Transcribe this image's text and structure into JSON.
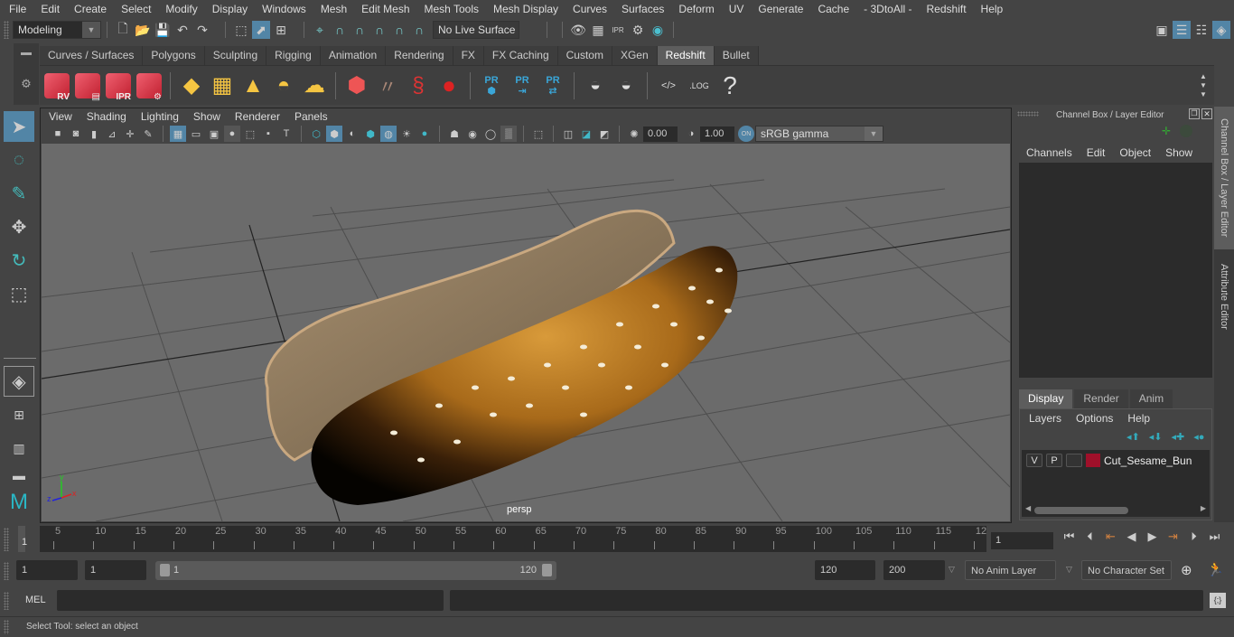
{
  "menubar": {
    "items": [
      "File",
      "Edit",
      "Create",
      "Select",
      "Modify",
      "Display",
      "Windows",
      "Mesh",
      "Edit Mesh",
      "Mesh Tools",
      "Mesh Display",
      "Curves",
      "Surfaces",
      "Deform",
      "UV",
      "Generate",
      "Cache",
      "- 3DtoAll -",
      "Redshift",
      "Help"
    ]
  },
  "toolbar": {
    "mode_select": "Modeling",
    "live_surface": "No Live Surface"
  },
  "shelf": {
    "tabs": [
      "Curves / Surfaces",
      "Polygons",
      "Sculpting",
      "Rigging",
      "Animation",
      "Rendering",
      "FX",
      "FX Caching",
      "Custom",
      "XGen",
      "Redshift",
      "Bullet"
    ],
    "active_tab": "Redshift",
    "icons": [
      {
        "name": "redshift-render-view",
        "label": "RV"
      },
      {
        "name": "redshift-batch-render",
        "label": ""
      },
      {
        "name": "redshift-ipr",
        "label": "IPR"
      },
      {
        "name": "redshift-settings",
        "label": ""
      },
      {
        "name": "redshift-area-light",
        "label": ""
      },
      {
        "name": "redshift-portal-light",
        "label": ""
      },
      {
        "name": "redshift-spot-light",
        "label": ""
      },
      {
        "name": "redshift-dome-light",
        "label": ""
      },
      {
        "name": "redshift-sun-sky",
        "label": ""
      },
      {
        "name": "redshift-proxy",
        "label": ""
      },
      {
        "name": "redshift-hair",
        "label": ""
      },
      {
        "name": "redshift-volume",
        "label": ""
      },
      {
        "name": "redshift-sphere",
        "label": ""
      },
      {
        "name": "pr-create",
        "label": "PR"
      },
      {
        "name": "pr-export",
        "label": "PR"
      },
      {
        "name": "pr-sync",
        "label": "PR"
      },
      {
        "name": "bake-all",
        "label": ""
      },
      {
        "name": "bake-selected",
        "label": ""
      },
      {
        "name": "script-editor",
        "label": ""
      },
      {
        "name": "log",
        "label": ".LOG"
      },
      {
        "name": "help",
        "label": "?"
      }
    ]
  },
  "viewport": {
    "menu": [
      "View",
      "Shading",
      "Lighting",
      "Show",
      "Renderer",
      "Panels"
    ],
    "exposure": "0.00",
    "gamma": "1.00",
    "color_mgmt_toggle": "ON",
    "color_space": "sRGB gamma",
    "camera_label": "persp",
    "axis": {
      "x": "x",
      "y": "y",
      "z": "z"
    }
  },
  "channel_box": {
    "title": "Channel Box / Layer Editor",
    "menu": [
      "Channels",
      "Edit",
      "Object",
      "Show"
    ]
  },
  "layer_editor": {
    "tabs": [
      "Display",
      "Render",
      "Anim"
    ],
    "active_tab": "Display",
    "menu": [
      "Layers",
      "Options",
      "Help"
    ],
    "layers": [
      {
        "visible": "V",
        "playback": "P",
        "type": "",
        "color": "#a0102a",
        "name": "Cut_Sesame_Bun"
      }
    ]
  },
  "side_tabs": [
    "Channel Box / Layer Editor",
    "Attribute Editor"
  ],
  "timeline": {
    "start_label": "1",
    "ticks": [
      "5",
      "10",
      "15",
      "20",
      "25",
      "30",
      "35",
      "40",
      "45",
      "50",
      "55",
      "60",
      "65",
      "70",
      "75",
      "80",
      "85",
      "90",
      "95",
      "100",
      "105",
      "110",
      "115",
      "12"
    ],
    "current_frame": "1"
  },
  "range": {
    "start_frame": "1",
    "playback_start": "1",
    "range_start": "1",
    "range_end": "120",
    "playback_end": "120",
    "end_frame": "200",
    "anim_layer": "No Anim Layer",
    "character_set": "No Character Set"
  },
  "command_line": {
    "language": "MEL",
    "input": "",
    "result": ""
  },
  "status_bar": {
    "message": "Select Tool: select an object"
  }
}
